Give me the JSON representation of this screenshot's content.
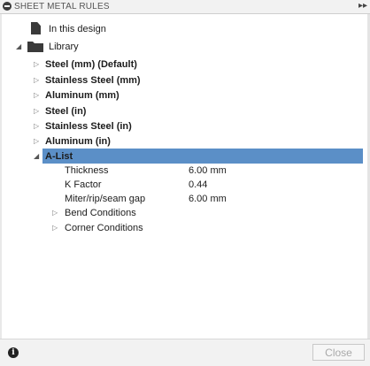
{
  "panel": {
    "title": "SHEET METAL RULES",
    "expand_icon": "double-chevron-right-icon"
  },
  "tree": {
    "in_this_design": "In this design",
    "library": "Library",
    "rules": [
      "Steel (mm) (Default)",
      "Stainless Steel (mm)",
      "Aluminum (mm)",
      "Steel (in)",
      "Stainless Steel (in)",
      "Aluminum (in)"
    ],
    "selected_rule": "A-List",
    "properties": [
      {
        "label": "Thickness",
        "value": "6.00 mm"
      },
      {
        "label": "K Factor",
        "value": "0.44"
      },
      {
        "label": "Miter/rip/seam gap",
        "value": "6.00 mm"
      }
    ],
    "subgroups": [
      "Bend Conditions",
      "Corner Conditions"
    ]
  },
  "footer": {
    "close_label": "Close",
    "info_icon": "info-icon"
  },
  "colors": {
    "selection": "#5b8fc7",
    "panel_bg": "#f2f2f2"
  }
}
